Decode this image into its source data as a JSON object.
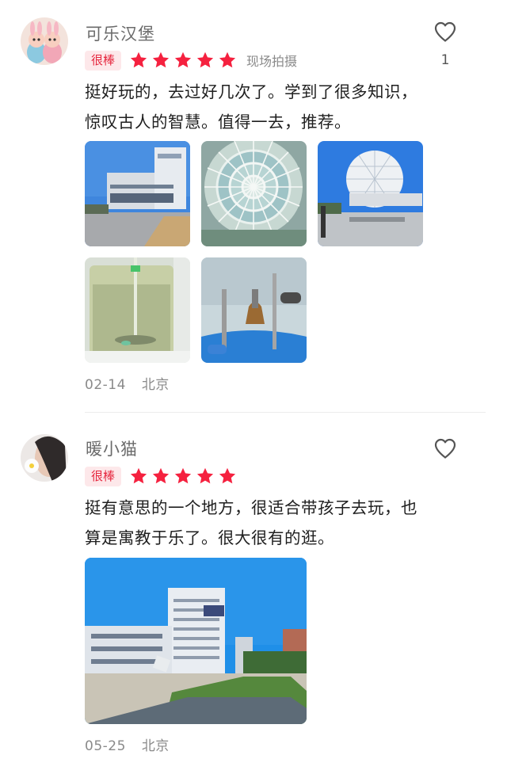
{
  "reviews": [
    {
      "username": "可乐汉堡",
      "badge": "很棒",
      "stars": 5,
      "tag": "现场拍摄",
      "likes": "1",
      "content": "挺好玩的，去过好几次了。学到了很多知识，惊叹古人的智慧。值得一去，推荐。",
      "date": "02-14",
      "location": "北京",
      "photos": [
        "museum-building",
        "glass-dome-ceiling",
        "geodesic-sphere",
        "water-experiment",
        "bell-exhibit"
      ]
    },
    {
      "username": "暖小猫",
      "badge": "很棒",
      "stars": 5,
      "content": "挺有意思的一个地方，很适合带孩子去玩，也算是寓教于乐了。很大很有的逛。",
      "date": "05-25",
      "location": "北京",
      "photos": [
        "tall-building-plaza"
      ]
    }
  ],
  "colors": {
    "accent": "#f5213f",
    "badge_bg": "#fde8ea",
    "muted_text": "#8a8a8a"
  },
  "icons": {
    "like": "heart-outline-icon",
    "rating": "star-filled-icon"
  }
}
